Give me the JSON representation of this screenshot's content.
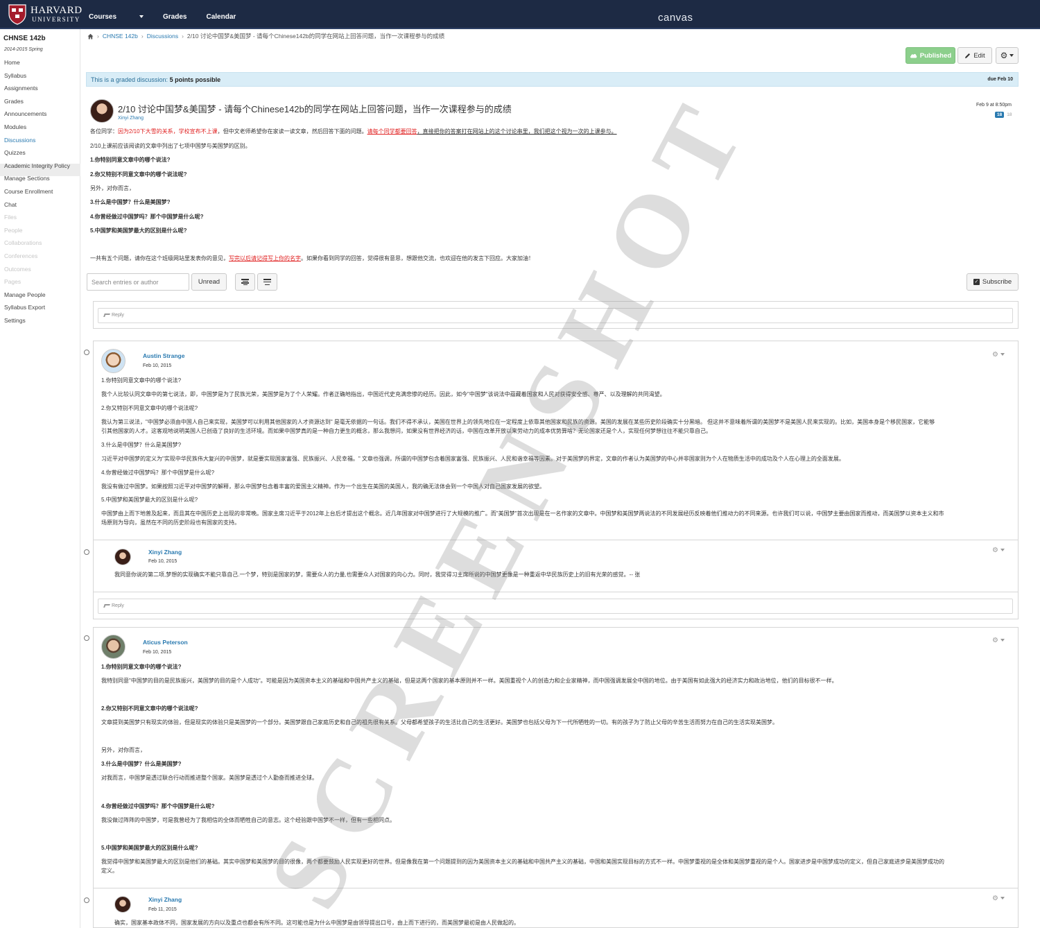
{
  "header": {
    "logo_line1": "HARVARD",
    "logo_line2": "UNIVERSITY",
    "nav": [
      "Courses",
      "Grades",
      "Calendar"
    ],
    "brand": "canvas"
  },
  "sidebar": {
    "course": "CHNSE 142b",
    "term": "2014-2015 Spring",
    "items": [
      {
        "label": "Home",
        "state": "normal"
      },
      {
        "label": "Syllabus",
        "state": "normal"
      },
      {
        "label": "Assignments",
        "state": "normal"
      },
      {
        "label": "Grades",
        "state": "normal"
      },
      {
        "label": "Announcements",
        "state": "normal"
      },
      {
        "label": "Modules",
        "state": "normal"
      },
      {
        "label": "Discussions",
        "state": "active"
      },
      {
        "label": "Quizzes",
        "state": "normal"
      },
      {
        "label": "Academic Integrity Policy",
        "state": "normal"
      },
      {
        "label": "Manage Sections",
        "state": "normal"
      },
      {
        "label": "Course Enrollment",
        "state": "normal"
      },
      {
        "label": "Chat",
        "state": "normal"
      },
      {
        "label": "Files",
        "state": "disabled"
      },
      {
        "label": "People",
        "state": "disabled"
      },
      {
        "label": "Collaborations",
        "state": "disabled"
      },
      {
        "label": "Conferences",
        "state": "disabled"
      },
      {
        "label": "Outcomes",
        "state": "disabled"
      },
      {
        "label": "Pages",
        "state": "disabled"
      },
      {
        "label": "Manage People",
        "state": "normal"
      },
      {
        "label": "Syllabus Export",
        "state": "normal"
      },
      {
        "label": "Settings",
        "state": "normal"
      }
    ]
  },
  "breadcrumb": {
    "course": "CHNSE 142b",
    "section": "Discussions",
    "current": "2/10 讨论中国梦&美国梦 - 请每个Chinese142b的同学在网站上回答问题，当作一次课程参与的成绩"
  },
  "buttons": {
    "published": "Published",
    "edit": "Edit",
    "unread": "Unread",
    "subscribe": "Subscribe",
    "reply": "Reply"
  },
  "graded": {
    "label": "This is a graded discussion:",
    "points": "5 points possible",
    "due": "due Feb 10"
  },
  "topic": {
    "title": "2/10 讨论中国梦&美国梦 - 请每个Chinese142b的同学在网站上回答问题，当作一次课程参与的成绩",
    "author": "Xinyi Zhang",
    "date": "Feb 9 at 8:50pm",
    "unread_count": "18",
    "total_count": "18",
    "intro_a": "各位同学：",
    "intro_b": "因为2/10下大雪的关系，学校宣布不上课",
    "intro_c": "，但中文老师希望你在家读一读文章，然后回答下面的问题。",
    "intro_d": "请每个同学都要回答",
    "intro_e": "，直接把你的答案打在网站上的这个讨论串里，我们把这个视为一次的上课参与。",
    "line2": "2/10上课前应该阅读的文章中列出了七项中国梦与美国梦的区别。",
    "q1": "1.你特别同意文章中的哪个说法?",
    "q2": "2.你又特别不同意文章中的哪个说法呢?",
    "also": "另外，对你而言，",
    "q3": "3.什么是中国梦？什么是美国梦?",
    "q4": "4.你曾经做过中国梦吗？那个中国梦是什么呢?",
    "q5": "5.中国梦和美国梦最大的区别是什么呢?",
    "close_a": "一共有五个问题，请你在这个班级网站里发表你的意见，",
    "close_b": "写完以后请记得写上你的名字",
    "close_c": "。如果你看到同学的回答，觉得很有意思，想跟他交流，也欢迎在他的发言下回应。大家加油！"
  },
  "search": {
    "placeholder": "Search entries or author"
  },
  "posts": [
    {
      "author": "Austin Strange",
      "date": "Feb 10, 2015",
      "lines": [
        "1.你特别同意文章中的哪个说法?",
        "我个人比较认同文章中的第七说法，即，中国梦是为了民族光荣，美国梦是为了个人荣耀。作者正确地指出，中国近代史充满悲惨的经历。因此，如今\"中国梦\"该说法中蕴藏着国家和人民对获得安全感、尊严、以及理解的共同渴望。",
        "2.你又特别不同意文章中的哪个说法呢?",
        "我认为第三说法，\"中国梦必须由中国人自己来实现，美国梦可以利用其他国家的人才资源达到\" 是毫无依据的一句话。我们不得不承认，美国在世界上的领先地位在一定程度上依靠其他国家和民族的资源。美国的发展在某些历史阶段确实十分黑暗。 但这并不意味着所谓的美国梦不是美国人民来实现的。比如，美国本身是个移民国家，它能够",
        "引其他国家的人才。这客观地说明美国人已创造了良好的生活环境。而如果中国梦真的是一种自力更生的概念，那么我想问，如果没有世界经济的话，中国在改革开放以来劳动力的成本优势算啥？无论国家还是个人，实现任何梦想往往不能只靠自己。",
        "3.什么是中国梦？什么是美国梦?",
        "习近平对中国梦的定义为\"实现中华民族伟大复兴的中国梦，就是要实现国家富强、民族振兴、人民幸福。\" 文章也强调，所谓的中国梦包含着国家富强、民族振兴、人民和谐幸福等因素。对于美国梦的界定，文章的作者认为美国梦的中心并非国家则为个人在物质生活中的成功及个人在心理上的全面发展。",
        "4.你曾经做过中国梦吗？那个中国梦是什么呢?",
        "我没有做过中国梦。如果按照习近平对中国梦的解释，那么中国梦包含着丰富的爱国主义精神。作为一个出生在美国的美国人，我的确无法体会到一个中国人对自己国家发展的欲望。",
        "5.中国梦和美国梦最大的区别是什么呢?",
        "中国梦由上而下地普及起来，而且其在中国历史上出现的非常晚。国家主席习近平于2012年上台后才提出这个概念。近几年国家对中国梦进行了大规模的推广。而\"美国梦\"首次出现是在一名作家的文章中。中国梦和美国梦两说法的不同发展经历反映着他们推动力的不同来源。也许我们可以说，中国梦主要由国家而推动，而美国梦以资本主义和市",
        "场原则为导向，虽然在不同的历史阶段也有国家的支持。"
      ],
      "reply": {
        "author": "Xinyi Zhang",
        "date": "Feb 10, 2015",
        "text": "我同意你说的第二项,梦想的实现确实不能只靠自己.一个梦，特别是国家的梦，需要众人的力量,也需要众人对国家的向心力。同时，我觉得习主席所说的中国梦更像是一种重返中华民族历史上的旧有光荣的感觉。-- 张"
      }
    },
    {
      "author": "Aticus Peterson",
      "date": "Feb 10, 2015",
      "lines": [
        "1.你特别同意文章中的哪个说法?",
        "我特别同意\"中国梦的目的是民族振兴，美国梦的目的是个人成功\"。可能是因为美国资本主义的基础和中国共产主义的基础，但是这两个国家的基本原则并不一样。美国重视个人的创造力和企业家精神，而中国强调发展全中国的地位。由于美国有如此强大的经济实力和政治地位，他们的目标很不一样。",
        "2.你又特别不同意文章中的哪个说法呢?",
        "文章提到美国梦只有现实的体验，但是现实的体验只是美国梦的一个部分。美国梦跟自己家庭历史和自己的祖先很有关系。父母都希望孩子的生活比自己的生活更好。美国梦也包括父母为下一代所牺牲的一切。有的孩子为了防止父母的辛苦生活而努力在自己的生活实现美国梦。",
        "另外，对你而言，",
        "3.什么是中国梦？什么是美国梦?",
        "对我而言，中国梦是透过联合行动而推进整个国家。美国梦是透过个人勤奋而推进全球。",
        "4.你曾经做过中国梦吗？那个中国梦是什么呢?",
        "我没做过阵阵的中国梦，可是我曾经为了我相信的全体而牺牲自己的意志。这个经验跟中国梦不一样，但有一些相同点。",
        "5.中国梦和美国梦最大的区别是什么呢?",
        "我觉得中国梦和美国梦最大的区别是他们的基础。其实中国梦和美国梦的目的很像，两个都要鼓励人民实现更好的世界。但是像我在第一个问题提到的因为美国资本主义的基础和中国共产主义的基础，中国和美国实现目标的方式不一样。中国梦重视的是全体和美国梦重视的是个人。国家进步是中国梦成功的定义，但自己家庭进步是美国梦成功的",
        "定义。"
      ],
      "reply": {
        "author": "Xinyi Zhang",
        "date": "Feb 11, 2015",
        "text": "确实，国家基本政体不同，国家发展的方向以及重点也都会有所不同。这可能也是为什么中国梦是由领导提出口号，由上而下进行的，而美国梦最初是由人民做起的。"
      }
    }
  ],
  "watermark": "SCREENSHOT"
}
